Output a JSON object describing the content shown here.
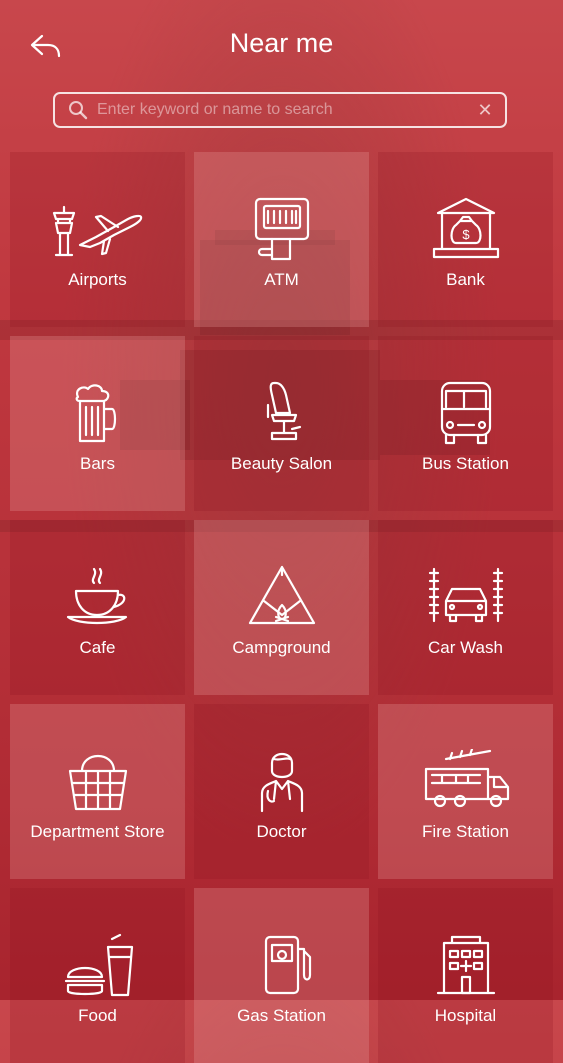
{
  "header": {
    "title": "Near me"
  },
  "search": {
    "placeholder": "Enter keyword or name to search",
    "value": ""
  },
  "categories": [
    {
      "label": "Airports",
      "icon": "airport-icon"
    },
    {
      "label": "ATM",
      "icon": "atm-icon"
    },
    {
      "label": "Bank",
      "icon": "bank-icon"
    },
    {
      "label": "Bars",
      "icon": "beer-mug-icon"
    },
    {
      "label": "Beauty Salon",
      "icon": "salon-chair-icon"
    },
    {
      "label": "Bus Station",
      "icon": "bus-icon"
    },
    {
      "label": "Cafe",
      "icon": "coffee-cup-icon"
    },
    {
      "label": "Campground",
      "icon": "tent-icon"
    },
    {
      "label": "Car Wash",
      "icon": "car-wash-icon"
    },
    {
      "label": "Department Store",
      "icon": "basket-icon"
    },
    {
      "label": "Doctor",
      "icon": "doctor-icon"
    },
    {
      "label": "Fire Station",
      "icon": "fire-truck-icon"
    },
    {
      "label": "Food",
      "icon": "burger-drink-icon"
    },
    {
      "label": "Gas Station",
      "icon": "gas-pump-icon"
    },
    {
      "label": "Hospital",
      "icon": "hospital-icon"
    }
  ]
}
